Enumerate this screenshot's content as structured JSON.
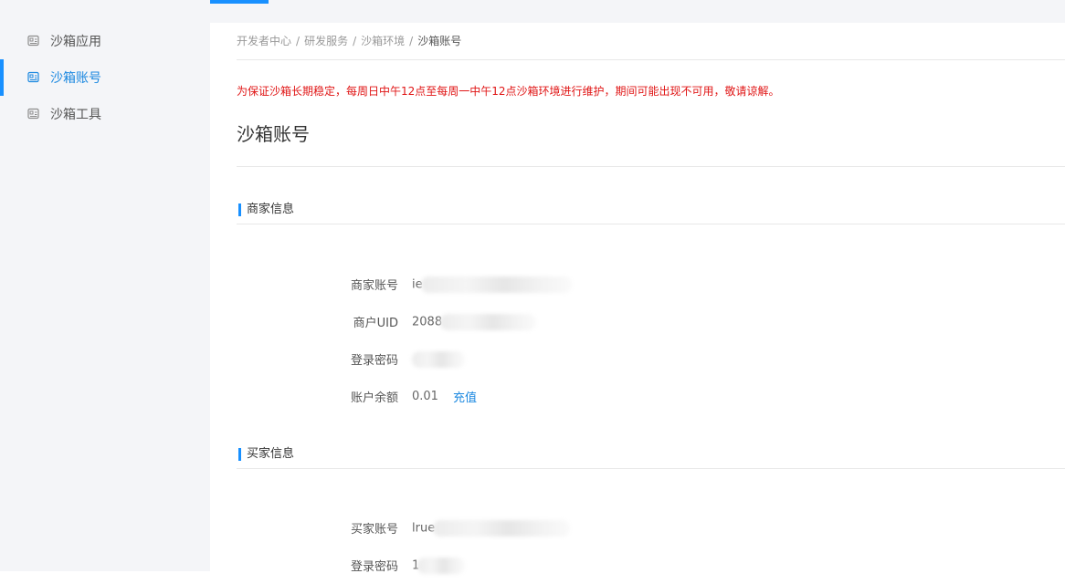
{
  "sidebar": {
    "items": [
      {
        "label": "沙箱应用",
        "icon": "app-icon",
        "active": false
      },
      {
        "label": "沙箱账号",
        "icon": "account-icon",
        "active": true
      },
      {
        "label": "沙箱工具",
        "icon": "tool-icon",
        "active": false
      }
    ]
  },
  "breadcrumb": {
    "items": [
      "开发者中心",
      "研发服务",
      "沙箱环境"
    ],
    "separator": "/",
    "current": "沙箱账号"
  },
  "notice": "为保证沙箱长期稳定，每周日中午12点至每周一中午12点沙箱环境进行维护，期间可能出现不可用，敬请谅解。",
  "page_title": "沙箱账号",
  "merchant": {
    "section_title": "商家信息",
    "account_label": "商家账号",
    "account_value": "ie",
    "uid_label": "商户UID",
    "uid_value": "2088",
    "password_label": "登录密码",
    "password_value": "",
    "balance_label": "账户余额",
    "balance_value": "0.01",
    "recharge_label": "充值"
  },
  "buyer": {
    "section_title": "买家信息",
    "account_label": "买家账号",
    "account_value": "lrue",
    "password_label": "登录密码",
    "password_value": "1"
  },
  "colors": {
    "accent": "#1890ff",
    "notice": "#e01515",
    "sidebar_bg": "#f4f5f8"
  }
}
